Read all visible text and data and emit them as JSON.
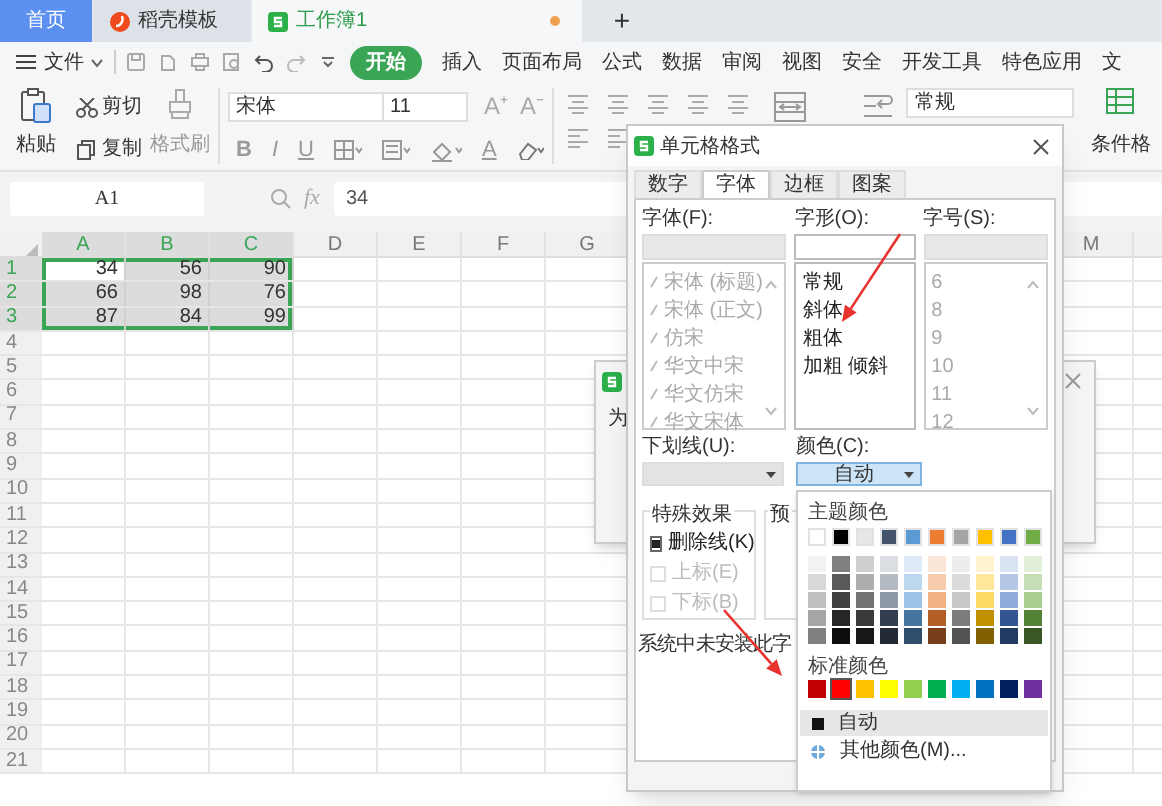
{
  "tabs": [
    {
      "label": "首页",
      "kind": "home",
      "selected": false
    },
    {
      "label": "稻壳模板",
      "kind": "template",
      "selected": false
    },
    {
      "label": "工作簿1",
      "kind": "workbook",
      "selected": true,
      "unsaved": true
    }
  ],
  "new_tab": "+",
  "menu": {
    "file": "文件",
    "items": [
      {
        "label": "开始",
        "selected": true
      },
      {
        "label": "插入",
        "selected": false
      },
      {
        "label": "页面布局",
        "selected": false
      },
      {
        "label": "公式",
        "selected": false
      },
      {
        "label": "数据",
        "selected": false
      },
      {
        "label": "审阅",
        "selected": false
      },
      {
        "label": "视图",
        "selected": false
      },
      {
        "label": "安全",
        "selected": false
      },
      {
        "label": "开发工具",
        "selected": false
      },
      {
        "label": "特色应用",
        "selected": false
      },
      {
        "label": "文",
        "selected": false
      }
    ]
  },
  "ribbon": {
    "paste": "粘贴",
    "cut": "剪切",
    "copy": "复制",
    "format_painter": "格式刷",
    "font": "宋体",
    "size": "11",
    "grow": "A⁺",
    "shrink": "A⁻",
    "bold": "B",
    "italic": "I",
    "underline": "U",
    "font_color": "A",
    "number_format": "常规",
    "conditional_format": "条件格"
  },
  "formula_bar": {
    "name_box": "A1",
    "fx": "fx",
    "value": "34"
  },
  "sheet": {
    "columns": [
      {
        "label": "A",
        "selected": true
      },
      {
        "label": "B",
        "selected": true
      },
      {
        "label": "C",
        "selected": true
      },
      {
        "label": "D",
        "selected": false
      },
      {
        "label": "E",
        "selected": false
      },
      {
        "label": "F",
        "selected": false
      },
      {
        "label": "G",
        "selected": false
      },
      {
        "label": "M",
        "selected": false
      }
    ],
    "rows": [
      {
        "label": "1",
        "selected": true,
        "cells": [
          {
            "value": "34",
            "active": true
          },
          {
            "value": "56",
            "active": false
          },
          {
            "value": "90",
            "active": false
          }
        ]
      },
      {
        "label": "2",
        "selected": true,
        "cells": [
          {
            "value": "66",
            "active": false
          },
          {
            "value": "98",
            "active": false
          },
          {
            "value": "76",
            "active": false
          }
        ]
      },
      {
        "label": "3",
        "selected": true,
        "cells": [
          {
            "value": "87",
            "active": false
          },
          {
            "value": "84",
            "active": false
          },
          {
            "value": "99",
            "active": false
          }
        ]
      },
      {
        "label": "4",
        "selected": false
      },
      {
        "label": "5",
        "selected": false
      },
      {
        "label": "6",
        "selected": false
      },
      {
        "label": "7",
        "selected": false
      },
      {
        "label": "8",
        "selected": false
      },
      {
        "label": "9",
        "selected": false
      },
      {
        "label": "10",
        "selected": false
      },
      {
        "label": "11",
        "selected": false
      },
      {
        "label": "12",
        "selected": false
      },
      {
        "label": "13",
        "selected": false
      },
      {
        "label": "14",
        "selected": false
      },
      {
        "label": "15",
        "selected": false
      },
      {
        "label": "16",
        "selected": false
      },
      {
        "label": "17",
        "selected": false
      },
      {
        "label": "18",
        "selected": false
      },
      {
        "label": "19",
        "selected": false
      },
      {
        "label": "20",
        "selected": false
      },
      {
        "label": "21",
        "selected": false
      }
    ]
  },
  "background_dialog": {
    "text": "为"
  },
  "dialog": {
    "title": "单元格格式",
    "tabs": [
      {
        "label": "数字",
        "selected": false
      },
      {
        "label": "字体",
        "selected": true
      },
      {
        "label": "边框",
        "selected": false
      },
      {
        "label": "图案",
        "selected": false
      }
    ],
    "font": {
      "label": "字体(F):",
      "disabled": true,
      "items": [
        "宋体 (标题)",
        "宋体 (正文)",
        "仿宋",
        "华文中宋",
        "华文仿宋",
        "华文宋体"
      ]
    },
    "style": {
      "label": "字形(O):",
      "disabled": false,
      "items": [
        "常规",
        "斜体",
        "粗体",
        "加粗 倾斜"
      ]
    },
    "size": {
      "label": "字号(S):",
      "disabled": true,
      "items": [
        "6",
        "8",
        "9",
        "10",
        "11",
        "12"
      ]
    },
    "underline": {
      "label": "下划线(U):",
      "disabled": true
    },
    "color": {
      "label": "颜色(C):",
      "value": "自动",
      "expanded": true
    },
    "effects": {
      "title": "特殊效果",
      "options": [
        {
          "label": "删除线(K)",
          "checked": true,
          "disabled": false
        },
        {
          "label": "上标(E)",
          "checked": false,
          "disabled": true
        },
        {
          "label": "下标(B)",
          "checked": false,
          "disabled": true
        }
      ]
    },
    "preview": {
      "label": "预"
    },
    "note": "系统中未安装此字"
  },
  "color_palette": {
    "theme_label": "主题颜色",
    "theme_colors": [
      {
        "color": "#ffffff"
      },
      {
        "color": "#000000"
      },
      {
        "color": "#e7e6e6"
      },
      {
        "color": "#44546a"
      },
      {
        "color": "#5b9bd5"
      },
      {
        "color": "#ed7d31"
      },
      {
        "color": "#a5a5a5"
      },
      {
        "color": "#ffc000"
      },
      {
        "color": "#4472c4"
      },
      {
        "color": "#70ad47"
      }
    ],
    "standard_label": "标准颜色",
    "standard_colors": [
      {
        "color": "#c00000",
        "selected": false
      },
      {
        "color": "#ff0000",
        "selected": true
      },
      {
        "color": "#ffc000",
        "selected": false
      },
      {
        "color": "#ffff00",
        "selected": false
      },
      {
        "color": "#92d050",
        "selected": false
      },
      {
        "color": "#00b050",
        "selected": false
      },
      {
        "color": "#00b0f0",
        "selected": false
      },
      {
        "color": "#0070c0",
        "selected": false
      },
      {
        "color": "#002060",
        "selected": false
      },
      {
        "color": "#7030a0",
        "selected": false
      }
    ],
    "automatic": {
      "label": "自动",
      "selected": true
    },
    "more": "其他颜色(M)..."
  },
  "annotations": [
    {
      "kind": "arrow"
    },
    {
      "kind": "arrow"
    }
  ]
}
